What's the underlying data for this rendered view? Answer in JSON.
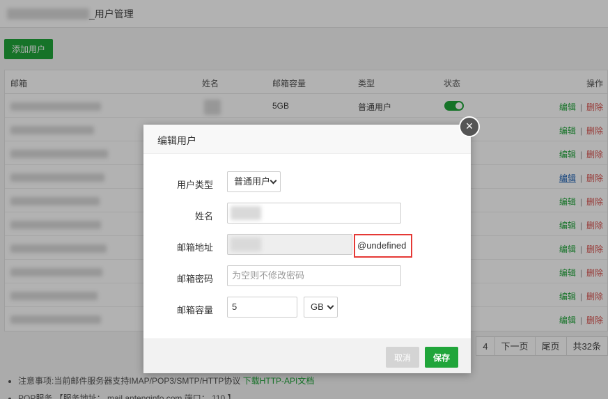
{
  "header": {
    "title": "_用户管理"
  },
  "toolbar": {
    "add_label": "添加用户"
  },
  "table": {
    "columns": {
      "email": "邮箱",
      "name": "姓名",
      "quota": "邮箱容量",
      "type": "类型",
      "status": "状态",
      "ops": "操作"
    },
    "first_row": {
      "quota": "5GB",
      "type": "普通用户"
    },
    "edit_label": "编辑",
    "delete_label": "删除",
    "sep": "|"
  },
  "pager": [
    "4",
    "下一页",
    "尾页",
    "共32条"
  ],
  "notes": {
    "item1_prefix": "注意事项:当前邮件服务器支持IMAP/POP3/SMTP/HTTP协议",
    "item1_link": "下载HTTP-API文档",
    "item2": "POP服务 【服务地址： mail.antenginfo.com  端口： 110 】"
  },
  "modal": {
    "title": "编辑用户",
    "close": "×",
    "fields": {
      "type_label": "用户类型",
      "type_value": "普通用户",
      "name_label": "姓名",
      "email_label": "邮箱地址",
      "email_suffix": "@undefined",
      "password_label": "邮箱密码",
      "password_placeholder": "为空则不修改密码",
      "quota_label": "邮箱容量",
      "quota_value": "5",
      "quota_unit": "GB"
    },
    "cancel_label": "取消",
    "save_label": "保存"
  },
  "colors": {
    "accent": "#20a53a",
    "danger": "#d9534f",
    "highlight": "#e53935"
  }
}
